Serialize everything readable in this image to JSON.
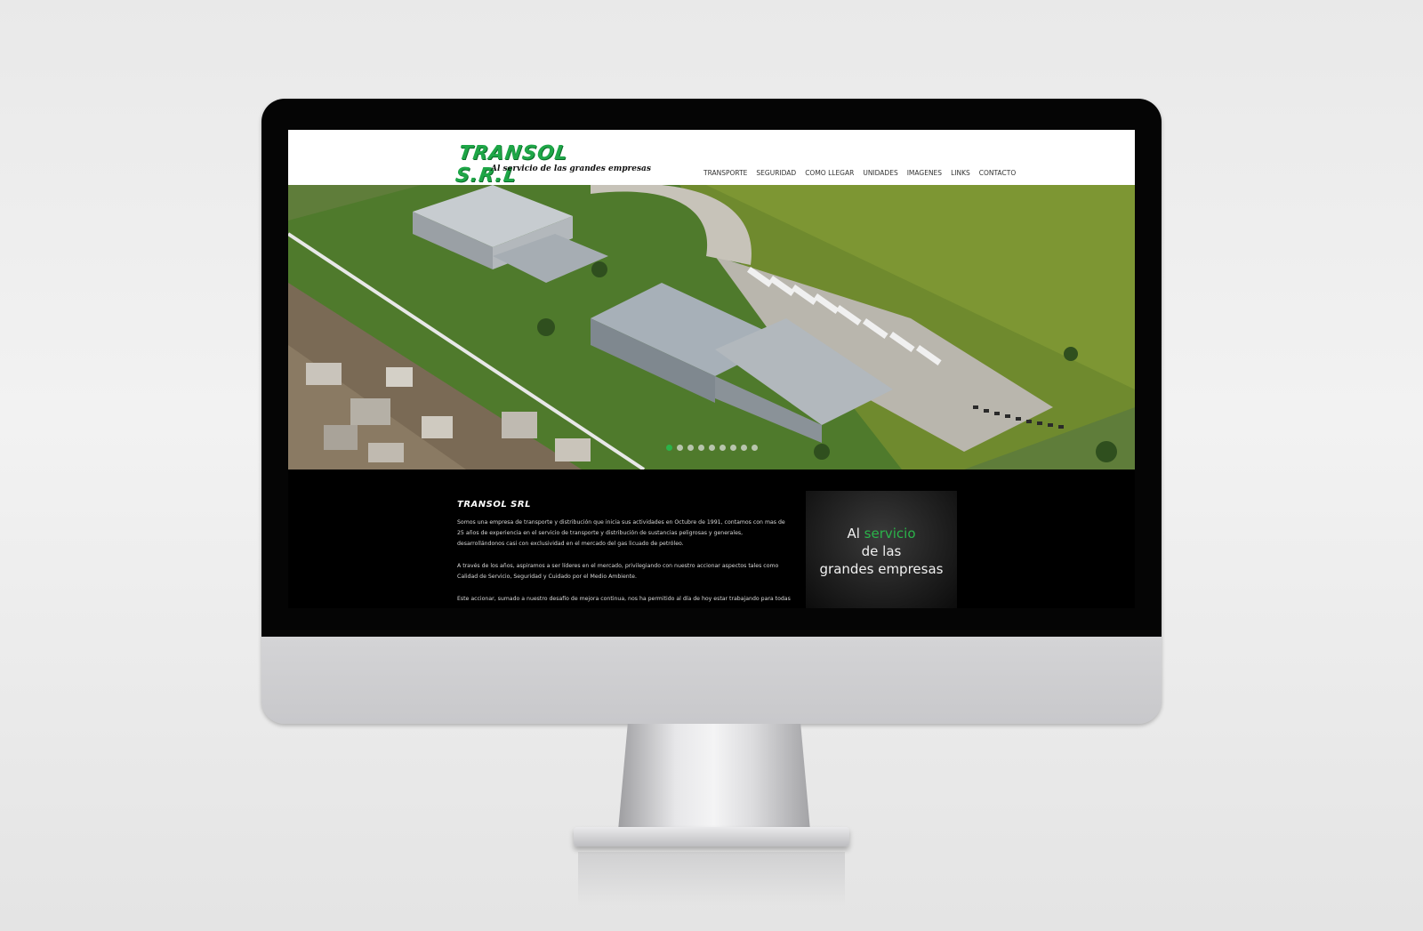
{
  "site": {
    "logo": {
      "name": "TRANSOL S.R.L",
      "tagline": "Al servicio de las grandes empresas"
    },
    "nav": {
      "items": [
        "TRANSPORTE",
        "SEGURIDAD",
        "COMO LLEGAR",
        "UNIDADES",
        "IMAGENES",
        "LINKS",
        "CONTACTO"
      ]
    },
    "slider": {
      "slide_count": 9,
      "active_index": 0,
      "image": "aerial-facility-photo"
    },
    "about": {
      "title": "TRANSOL SRL",
      "p1": "Somos una empresa de transporte y distribución que inicia sus actividades en Octubre de 1991, contamos con mas de 25 años de experiencia en el servicio de transporte y distribución de sustancias peligrosas y generales, desarrollándonos casi con exclusividad en el mercado del gas licuado de petróleo.",
      "p2": "A través de los años, aspiramos a ser líderes en el mercado, privilegiando con nuestro accionar aspectos tales como Calidad de Servicio, Seguridad y Cuidado por el Medio Ambiente.",
      "p3": "Este accionar, sumado a nuestro desafío de mejora continua, nos ha permitido al día de hoy estar trabajando para todas"
    },
    "promo": {
      "word1": "Al",
      "word2": "servicio",
      "line2": "de las",
      "line3": "grandes empresas"
    },
    "colors": {
      "brand_green": "#2bb34a",
      "header_bg": "#ffffff",
      "content_bg": "#000000"
    }
  }
}
